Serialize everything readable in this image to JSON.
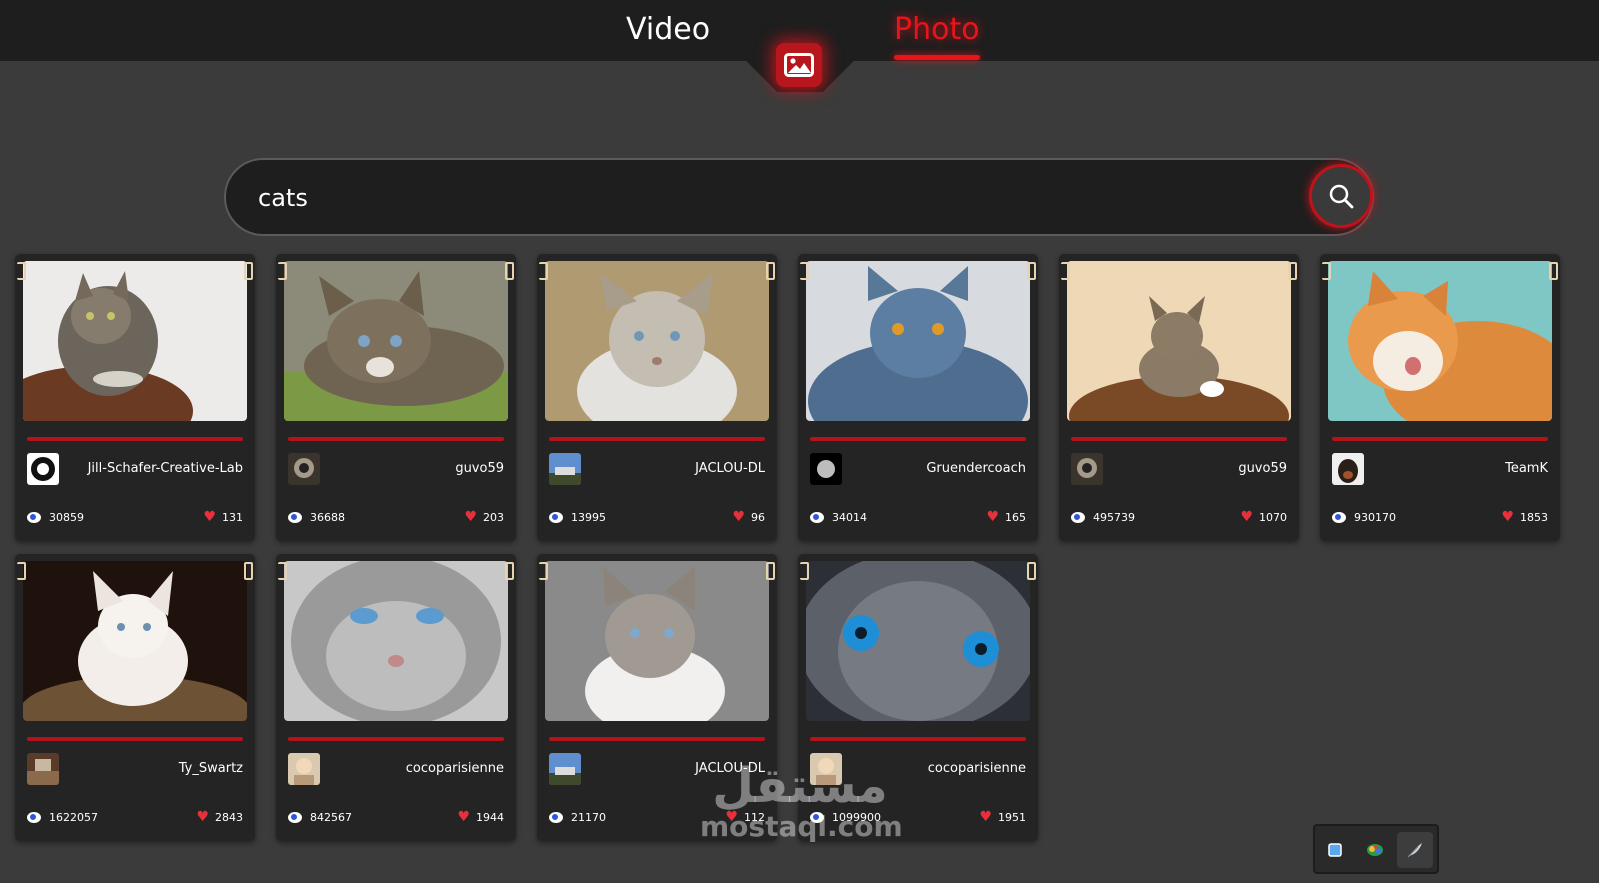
{
  "nav": {
    "video_label": "Video",
    "photo_label": "Photo",
    "active_tab": "Photo",
    "center_icon": "image-icon"
  },
  "search": {
    "value": "cats",
    "button_icon": "search-icon"
  },
  "colors": {
    "accent": "#e8141c",
    "card_bg": "#242424",
    "page_bg": "#3b3b3b",
    "bar_bg": "#1e1e1e"
  },
  "cards": [
    {
      "user": "Jill-Schafer-Creative-Lab",
      "views": "30859",
      "likes": "131"
    },
    {
      "user": "guvo59",
      "views": "36688",
      "likes": "203"
    },
    {
      "user": "JACLOU-DL",
      "views": "13995",
      "likes": "96"
    },
    {
      "user": "Gruendercoach",
      "views": "34014",
      "likes": "165"
    },
    {
      "user": "guvo59",
      "views": "495739",
      "likes": "1070"
    },
    {
      "user": "TeamK",
      "views": "930170",
      "likes": "1853"
    },
    {
      "user": "Ty_Swartz",
      "views": "1622057",
      "likes": "2843"
    },
    {
      "user": "cocoparisienne",
      "views": "842567",
      "likes": "1944"
    },
    {
      "user": "JACLOU-DL",
      "views": "21170",
      "likes": "112"
    },
    {
      "user": "cocoparisienne",
      "views": "1099900",
      "likes": "1951"
    }
  ],
  "watermark": {
    "arabic": "مستقل",
    "latin": "mostaql.com"
  },
  "widget": {
    "icons": [
      "square-icon",
      "color-wheel-icon",
      "feather-icon"
    ]
  }
}
